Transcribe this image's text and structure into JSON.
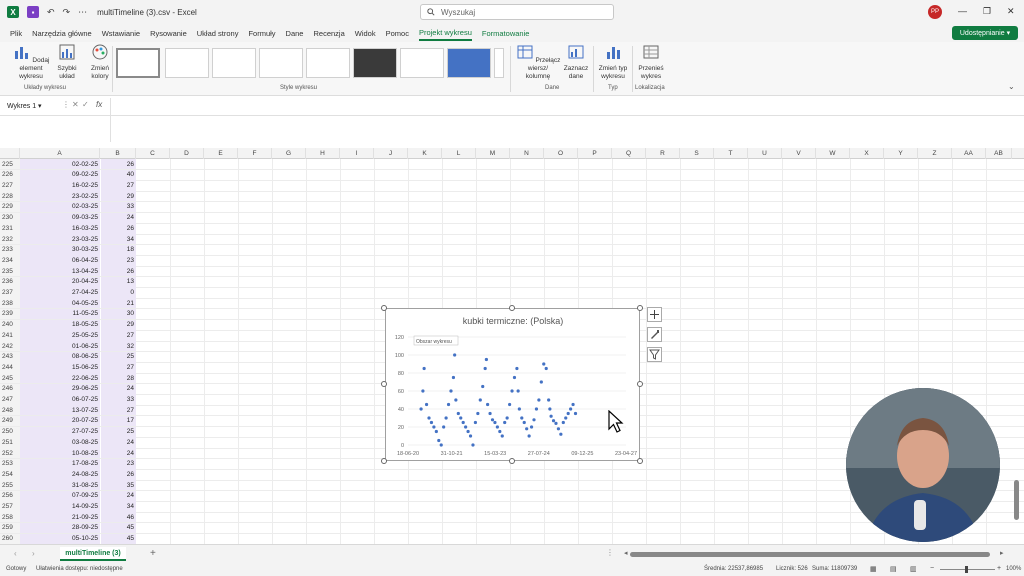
{
  "titlebar": {
    "undo": "↶",
    "redo": "↷",
    "more": "⋯",
    "filename": "multiTimeline (3).csv",
    "app": "Excel",
    "search_placeholder": "Wyszukaj",
    "user_initials": "PP"
  },
  "menu": [
    {
      "label": "Plik"
    },
    {
      "label": "Narzędzia główne"
    },
    {
      "label": "Wstawianie"
    },
    {
      "label": "Rysowanie"
    },
    {
      "label": "Układ strony"
    },
    {
      "label": "Formuły"
    },
    {
      "label": "Dane"
    },
    {
      "label": "Recenzja"
    },
    {
      "label": "Widok"
    },
    {
      "label": "Pomoc"
    },
    {
      "label": "Projekt wykresu"
    },
    {
      "label": "Formatowanie"
    }
  ],
  "share_label": "Udostępnianie",
  "ribbon": {
    "add_element": "Dodaj element wykresu",
    "quick_layout": "Szybki układ",
    "change_colors": "Zmień kolory",
    "group_layouts": "Układy wykresu",
    "group_styles": "Style wykresu",
    "switch_rowcol": "Przełącz wiersz/ kolumnę",
    "select_data": "Zaznacz dane",
    "group_data": "Dane",
    "change_type": "Zmień typ wykresu",
    "group_type": "Typ",
    "move_chart": "Przenieś wykres",
    "group_location": "Lokalizacja"
  },
  "namebox": "Wykres 1",
  "columns": [
    "A",
    "B",
    "C",
    "D",
    "E",
    "F",
    "G",
    "H",
    "I",
    "J",
    "K",
    "L",
    "M",
    "N",
    "O",
    "P",
    "Q",
    "R",
    "S",
    "T",
    "U",
    "V",
    "W",
    "X",
    "Y",
    "Z",
    "AA",
    "AB"
  ],
  "rows": [
    {
      "n": "225",
      "a": "02-02-25",
      "b": "26"
    },
    {
      "n": "226",
      "a": "09-02-25",
      "b": "40"
    },
    {
      "n": "227",
      "a": "16-02-25",
      "b": "27"
    },
    {
      "n": "228",
      "a": "23-02-25",
      "b": "29"
    },
    {
      "n": "229",
      "a": "02-03-25",
      "b": "33"
    },
    {
      "n": "230",
      "a": "09-03-25",
      "b": "24"
    },
    {
      "n": "231",
      "a": "16-03-25",
      "b": "26"
    },
    {
      "n": "232",
      "a": "23-03-25",
      "b": "34"
    },
    {
      "n": "233",
      "a": "30-03-25",
      "b": "18"
    },
    {
      "n": "234",
      "a": "06-04-25",
      "b": "23"
    },
    {
      "n": "235",
      "a": "13-04-25",
      "b": "26"
    },
    {
      "n": "236",
      "a": "20-04-25",
      "b": "13"
    },
    {
      "n": "237",
      "a": "27-04-25",
      "b": "0"
    },
    {
      "n": "238",
      "a": "04-05-25",
      "b": "21"
    },
    {
      "n": "239",
      "a": "11-05-25",
      "b": "30"
    },
    {
      "n": "240",
      "a": "18-05-25",
      "b": "29"
    },
    {
      "n": "241",
      "a": "25-05-25",
      "b": "27"
    },
    {
      "n": "242",
      "a": "01-06-25",
      "b": "32"
    },
    {
      "n": "243",
      "a": "08-06-25",
      "b": "25"
    },
    {
      "n": "244",
      "a": "15-06-25",
      "b": "27"
    },
    {
      "n": "245",
      "a": "22-06-25",
      "b": "28"
    },
    {
      "n": "246",
      "a": "29-06-25",
      "b": "24"
    },
    {
      "n": "247",
      "a": "06-07-25",
      "b": "33"
    },
    {
      "n": "248",
      "a": "13-07-25",
      "b": "27"
    },
    {
      "n": "249",
      "a": "20-07-25",
      "b": "17"
    },
    {
      "n": "250",
      "a": "27-07-25",
      "b": "25"
    },
    {
      "n": "251",
      "a": "03-08-25",
      "b": "24"
    },
    {
      "n": "252",
      "a": "10-08-25",
      "b": "24"
    },
    {
      "n": "253",
      "a": "17-08-25",
      "b": "23"
    },
    {
      "n": "254",
      "a": "24-08-25",
      "b": "26"
    },
    {
      "n": "255",
      "a": "31-08-25",
      "b": "35"
    },
    {
      "n": "256",
      "a": "07-09-25",
      "b": "24"
    },
    {
      "n": "257",
      "a": "14-09-25",
      "b": "34"
    },
    {
      "n": "258",
      "a": "21-09-25",
      "b": "46"
    },
    {
      "n": "259",
      "a": "28-09-25",
      "b": "45"
    },
    {
      "n": "260",
      "a": "05-10-25",
      "b": "45"
    }
  ],
  "chart_data": {
    "type": "scatter",
    "title": "kubki termiczne: (Polska)",
    "tooltip": "Obszar wykresu",
    "ylim": [
      0,
      120
    ],
    "yticks": [
      "0",
      "20",
      "40",
      "60",
      "80",
      "100",
      "120"
    ],
    "xticks": [
      "18-06-20",
      "31-10-21",
      "15-03-23",
      "27-07-24",
      "09-12-25",
      "23-04-27"
    ],
    "xlim": [
      "2020-06-18",
      "2027-04-23"
    ],
    "points_x": [
      "2020-11-15",
      "2020-12-06",
      "2020-12-20",
      "2021-01-17",
      "2021-02-14",
      "2021-03-14",
      "2021-04-11",
      "2021-05-09",
      "2021-06-06",
      "2021-07-04",
      "2021-08-01",
      "2021-08-29",
      "2021-09-26",
      "2021-10-24",
      "2021-11-21",
      "2021-12-05",
      "2021-12-19",
      "2022-01-16",
      "2022-02-13",
      "2022-03-13",
      "2022-04-10",
      "2022-05-08",
      "2022-06-05",
      "2022-07-03",
      "2022-07-31",
      "2022-08-28",
      "2022-09-25",
      "2022-10-23",
      "2022-11-20",
      "2022-12-04",
      "2022-12-18",
      "2023-01-15",
      "2023-02-12",
      "2023-03-12",
      "2023-04-09",
      "2023-05-07",
      "2023-06-04",
      "2023-07-02",
      "2023-07-30",
      "2023-08-27",
      "2023-09-24",
      "2023-10-22",
      "2023-11-19",
      "2023-12-03",
      "2023-12-17",
      "2024-01-14",
      "2024-02-11",
      "2024-03-10",
      "2024-04-07",
      "2024-05-05",
      "2024-06-02",
      "2024-06-30",
      "2024-07-28",
      "2024-08-25",
      "2024-09-22",
      "2024-10-20",
      "2024-11-17",
      "2024-12-01",
      "2024-12-15",
      "2025-01-12",
      "2025-02-09",
      "2025-03-09",
      "2025-04-06",
      "2025-05-04",
      "2025-06-01",
      "2025-06-29",
      "2025-07-27",
      "2025-08-24",
      "2025-09-21"
    ],
    "points_y": [
      40,
      60,
      85,
      45,
      30,
      25,
      20,
      15,
      5,
      0,
      20,
      30,
      45,
      60,
      75,
      100,
      50,
      35,
      30,
      25,
      20,
      15,
      10,
      0,
      25,
      35,
      50,
      65,
      85,
      95,
      45,
      35,
      28,
      25,
      20,
      15,
      10,
      25,
      30,
      45,
      60,
      75,
      85,
      60,
      40,
      30,
      25,
      18,
      10,
      20,
      28,
      40,
      50,
      70,
      90,
      85,
      50,
      40,
      32,
      27,
      24,
      18,
      12,
      25,
      30,
      35,
      40,
      45,
      35
    ],
    "marker_color": "#4472c4"
  },
  "sheet_tab": "multiTimeline (3)",
  "status": {
    "ready": "Gotowy",
    "accessibility": "Ułatwienia dostępu: niedostępne",
    "avg": "Średnia: 22537,86985",
    "count": "Licznik: 526",
    "sum": "Suma: 11809739",
    "zoom": "100%"
  }
}
